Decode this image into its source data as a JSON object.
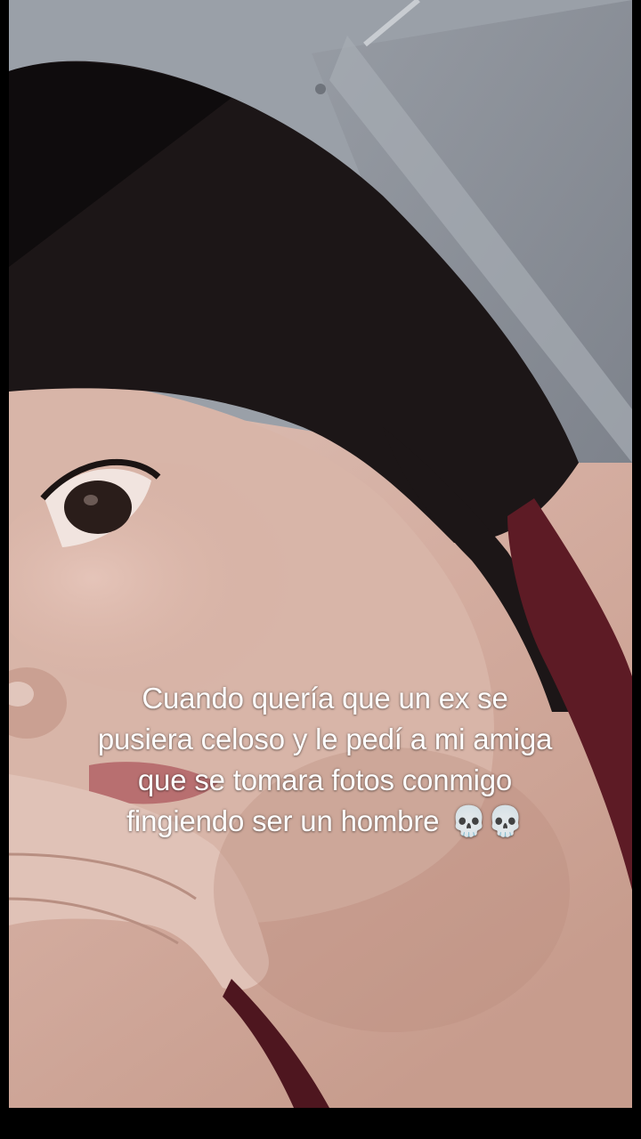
{
  "caption": {
    "text": "Cuando quería que un ex se pusiera celoso y le pedí a mi amiga que se tomara fotos conmigo fingiendo ser un hombre",
    "emoji": "💀💀"
  },
  "media": {
    "description_icon": "selfie-photo",
    "accent_colors": {
      "hair": "#1a1516",
      "skin": "#d9b7a9",
      "strap": "#6b1f2a",
      "curtain": "#8a8f97"
    }
  }
}
